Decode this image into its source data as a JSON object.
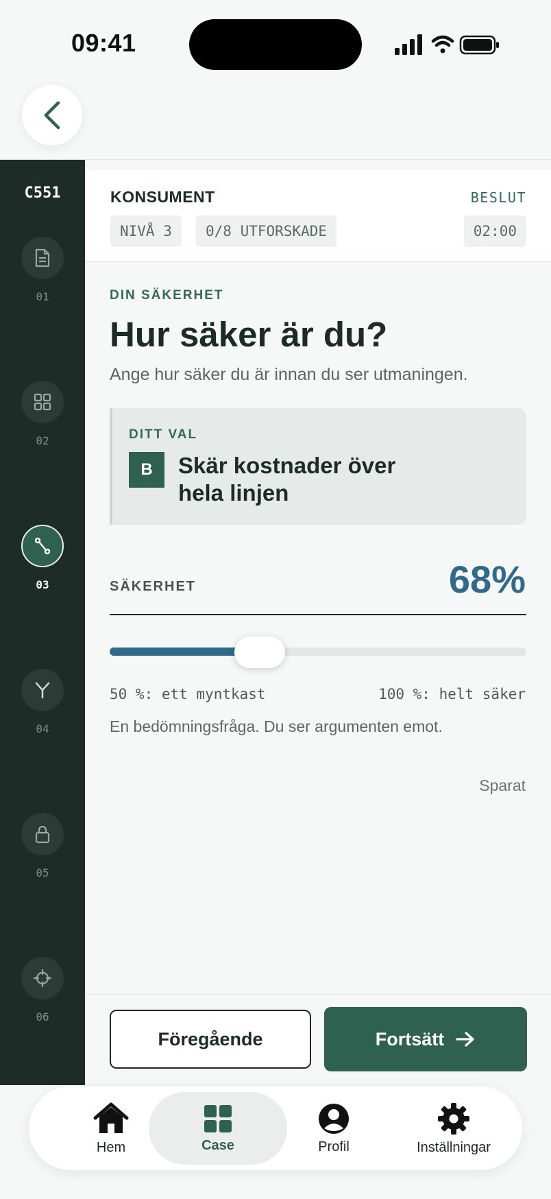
{
  "status": {
    "time": "09:41"
  },
  "rail": {
    "case_code": "C551",
    "steps": [
      {
        "num": "01",
        "icon": "document-icon"
      },
      {
        "num": "02",
        "icon": "grid-icon"
      },
      {
        "num": "03",
        "icon": "route-icon",
        "active": true
      },
      {
        "num": "04",
        "icon": "fork-icon"
      },
      {
        "num": "05",
        "icon": "lock-icon"
      },
      {
        "num": "06",
        "icon": "crosshair-icon"
      }
    ]
  },
  "header": {
    "title": "KONSUMENT",
    "phase": "BESLUT",
    "level": "NIVÅ 3",
    "explored": "0/8 UTFORSKADE",
    "timer": "02:00"
  },
  "main": {
    "eyebrow": "DIN SÄKERHET",
    "title": "Hur säker är du?",
    "subtitle": "Ange hur säker du är innan du ser utmaningen."
  },
  "choice": {
    "label": "DITT VAL",
    "badge": "B",
    "text": "Skär kostnader över hela linjen"
  },
  "confidence": {
    "label": "SÄKERHET",
    "value_text": "68%",
    "value": 68,
    "min": 50,
    "max": 100,
    "min_label": "50 %: ett myntkast",
    "max_label": "100 %: helt säker",
    "hint": "En bedömningsfråga. Du ser argumenten emot.",
    "saved": "Sparat"
  },
  "actions": {
    "previous": "Föregående",
    "next": "Fortsätt"
  },
  "tabs": [
    {
      "label": "Hem",
      "icon": "home-icon"
    },
    {
      "label": "Case",
      "icon": "case-grid-icon",
      "active": true
    },
    {
      "label": "Profil",
      "icon": "profile-icon"
    },
    {
      "label": "Inställningar",
      "icon": "settings-icon"
    }
  ],
  "colors": {
    "accent_green": "#2e6150",
    "rail_bg": "#1e2c27",
    "confidence_blue": "#2f6a8a"
  }
}
